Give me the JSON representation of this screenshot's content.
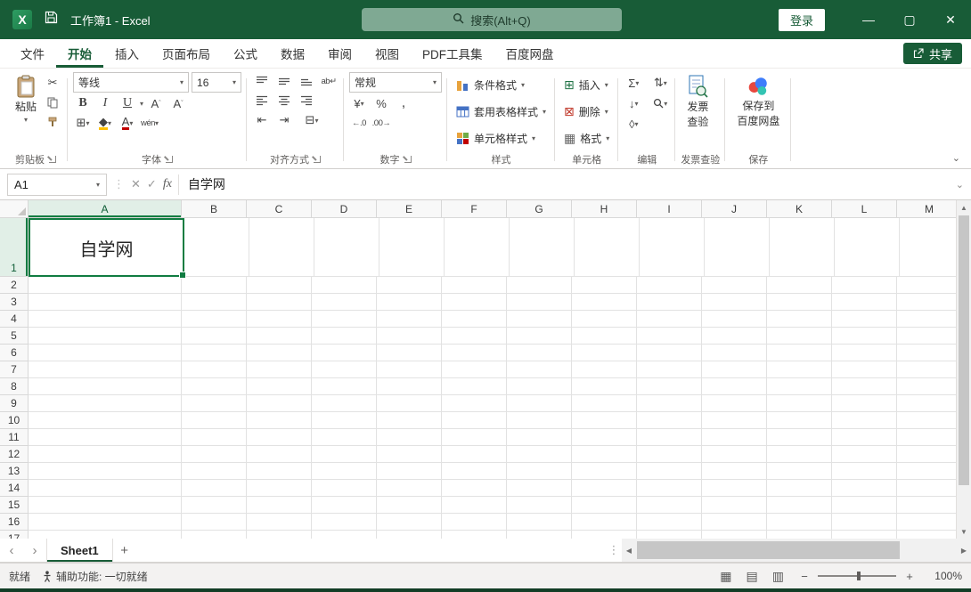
{
  "title_bar": {
    "app_initial": "X",
    "title": "工作簿1 - Excel",
    "search_placeholder": "搜索(Alt+Q)",
    "login_label": "登录"
  },
  "ribbon_tabs": {
    "items": [
      {
        "label": "文件"
      },
      {
        "label": "开始"
      },
      {
        "label": "插入"
      },
      {
        "label": "页面布局"
      },
      {
        "label": "公式"
      },
      {
        "label": "数据"
      },
      {
        "label": "审阅"
      },
      {
        "label": "视图"
      },
      {
        "label": "PDF工具集"
      },
      {
        "label": "百度网盘"
      }
    ],
    "share_label": "共享"
  },
  "ribbon": {
    "clipboard": {
      "label": "剪贴板",
      "paste_label": "粘贴"
    },
    "font": {
      "label": "字体",
      "font_name": "等线",
      "font_size": "16",
      "bold": "B",
      "italic": "I",
      "underline": "U",
      "phonetic": "wén"
    },
    "alignment": {
      "label": "对齐方式"
    },
    "number": {
      "label": "数字",
      "format": "常规",
      "inc_decimal": "←.0",
      "dec_decimal": ".00→"
    },
    "styles": {
      "label": "样式",
      "items": [
        "条件格式",
        "套用表格样式",
        "单元格样式"
      ]
    },
    "cells": {
      "label": "单元格",
      "items": [
        "插入",
        "删除",
        "格式"
      ]
    },
    "editing": {
      "label": "编辑"
    },
    "invoice": {
      "label": "发票查验",
      "line1": "发票",
      "line2": "查验"
    },
    "save": {
      "label": "保存",
      "line1": "保存到",
      "line2": "百度网盘"
    }
  },
  "formula_bar": {
    "name_box": "A1",
    "fx_label": "fx",
    "value": "自学网"
  },
  "grid": {
    "columns": [
      "A",
      "B",
      "C",
      "D",
      "E",
      "F",
      "G",
      "H",
      "I",
      "J",
      "K",
      "L",
      "M"
    ],
    "rows": [
      "1",
      "2",
      "3",
      "4",
      "5",
      "6",
      "7",
      "8",
      "9",
      "10",
      "11",
      "12",
      "13",
      "14",
      "15",
      "16",
      "17"
    ],
    "selected_cell": {
      "ref": "A1",
      "value": "自学网"
    },
    "selected_column": "A",
    "selected_row": "1"
  },
  "sheet_bar": {
    "tabs": [
      {
        "name": "Sheet1",
        "active": true
      }
    ],
    "add_label": "+"
  },
  "status_bar": {
    "ready_label": "就绪",
    "accessibility_label": "辅助功能: 一切就绪",
    "zoom_label": "100%"
  },
  "colors": {
    "titlebar_green": "#185C37",
    "accent_green": "#107C41",
    "fill_yellow": "#FFC000",
    "font_red": "#C00000"
  }
}
